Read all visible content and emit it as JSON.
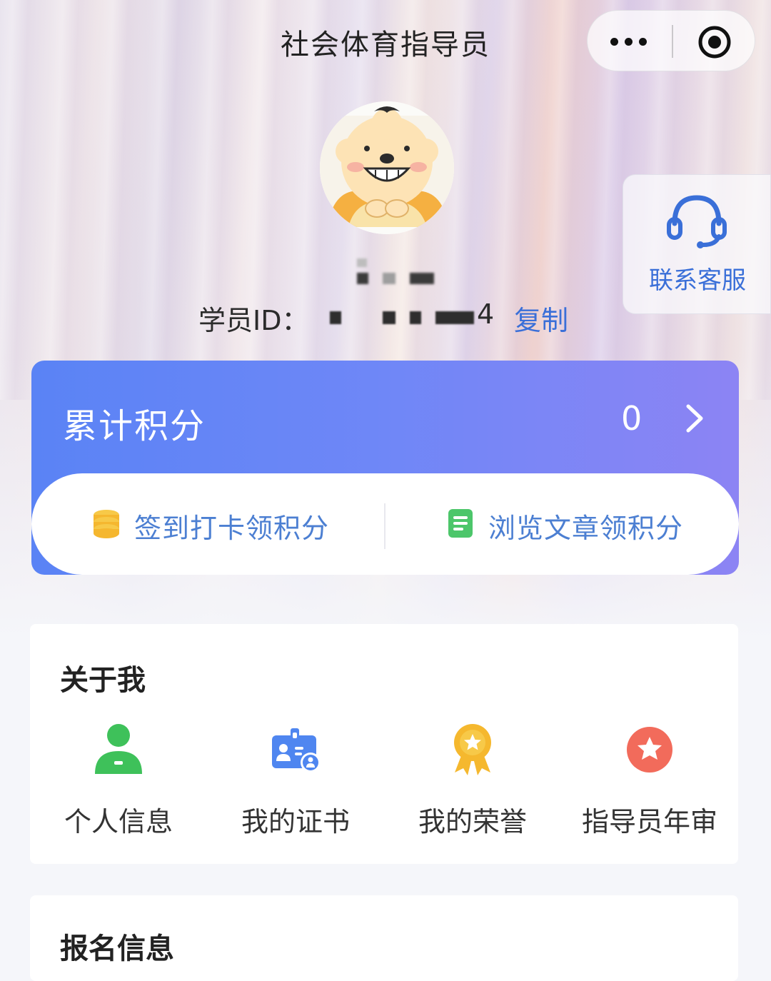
{
  "header": {
    "title": "社会体育指导员",
    "capsule_more_icon": "more-dots-icon",
    "capsule_close_icon": "target-circle-icon"
  },
  "profile": {
    "avatar_icon": "cartoon-sheep-avatar",
    "student_id_label": "学员ID：",
    "student_id_visible_digit": "4",
    "copy_label": "复制"
  },
  "service": {
    "icon": "headset-icon",
    "label": "联系客服"
  },
  "points": {
    "label": "累计积分",
    "value": "0",
    "checkin_label": "签到打卡领积分",
    "article_label": "浏览文章领积分"
  },
  "about": {
    "heading": "关于我",
    "items": [
      {
        "label": "个人信息",
        "icon": "person-icon",
        "color": "#3ec15a"
      },
      {
        "label": "我的证书",
        "icon": "id-card-icon",
        "color": "#4f86f0"
      },
      {
        "label": "我的荣誉",
        "icon": "medal-icon",
        "color": "#f5b82e"
      },
      {
        "label": "指导员年审",
        "icon": "star-badge-icon",
        "color": "#f26b5b"
      }
    ]
  },
  "signup": {
    "heading": "报名信息"
  },
  "colors": {
    "accent": "#3a6fd8",
    "card_gradient_start": "#5a83f5",
    "card_gradient_end": "#8c84f4"
  }
}
